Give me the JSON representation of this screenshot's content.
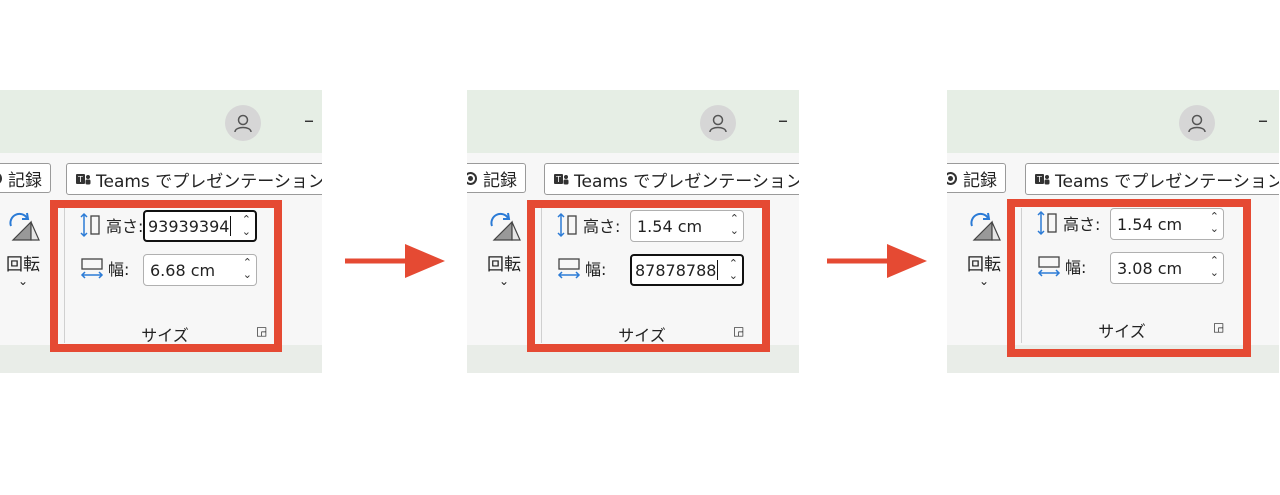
{
  "steps": [
    {
      "record_label": "記録",
      "teams_label": "Teams でプレゼンテーション",
      "rotate_label": "回転",
      "height_label": "高さ:",
      "width_label": "幅:",
      "height_value": "93939394",
      "width_value": "6.68 cm",
      "group_label": "サイズ"
    },
    {
      "record_label": "記録",
      "teams_label": "Teams でプレゼンテーション",
      "rotate_label": "回転",
      "height_label": "高さ:",
      "width_label": "幅:",
      "height_value": "1.54 cm",
      "width_value": "87878788",
      "group_label": "サイズ"
    },
    {
      "record_label": "記録",
      "teams_label": "Teams でプレゼンテーション",
      "rotate_label": "回転",
      "height_label": "高さ:",
      "width_label": "幅:",
      "height_value": "1.54 cm",
      "width_value": "3.08 cm",
      "group_label": "サイズ"
    }
  ],
  "colors": {
    "highlight": "#e54a33",
    "titlebar": "#e6eee5",
    "ribbon": "#f7f7f7"
  },
  "icons": [
    "user-avatar-icon",
    "minimize-icon",
    "record-icon",
    "teams-icon",
    "rotate-icon",
    "height-icon",
    "width-icon",
    "spin-icon",
    "dialog-launcher-icon",
    "right-arrow-icon"
  ]
}
